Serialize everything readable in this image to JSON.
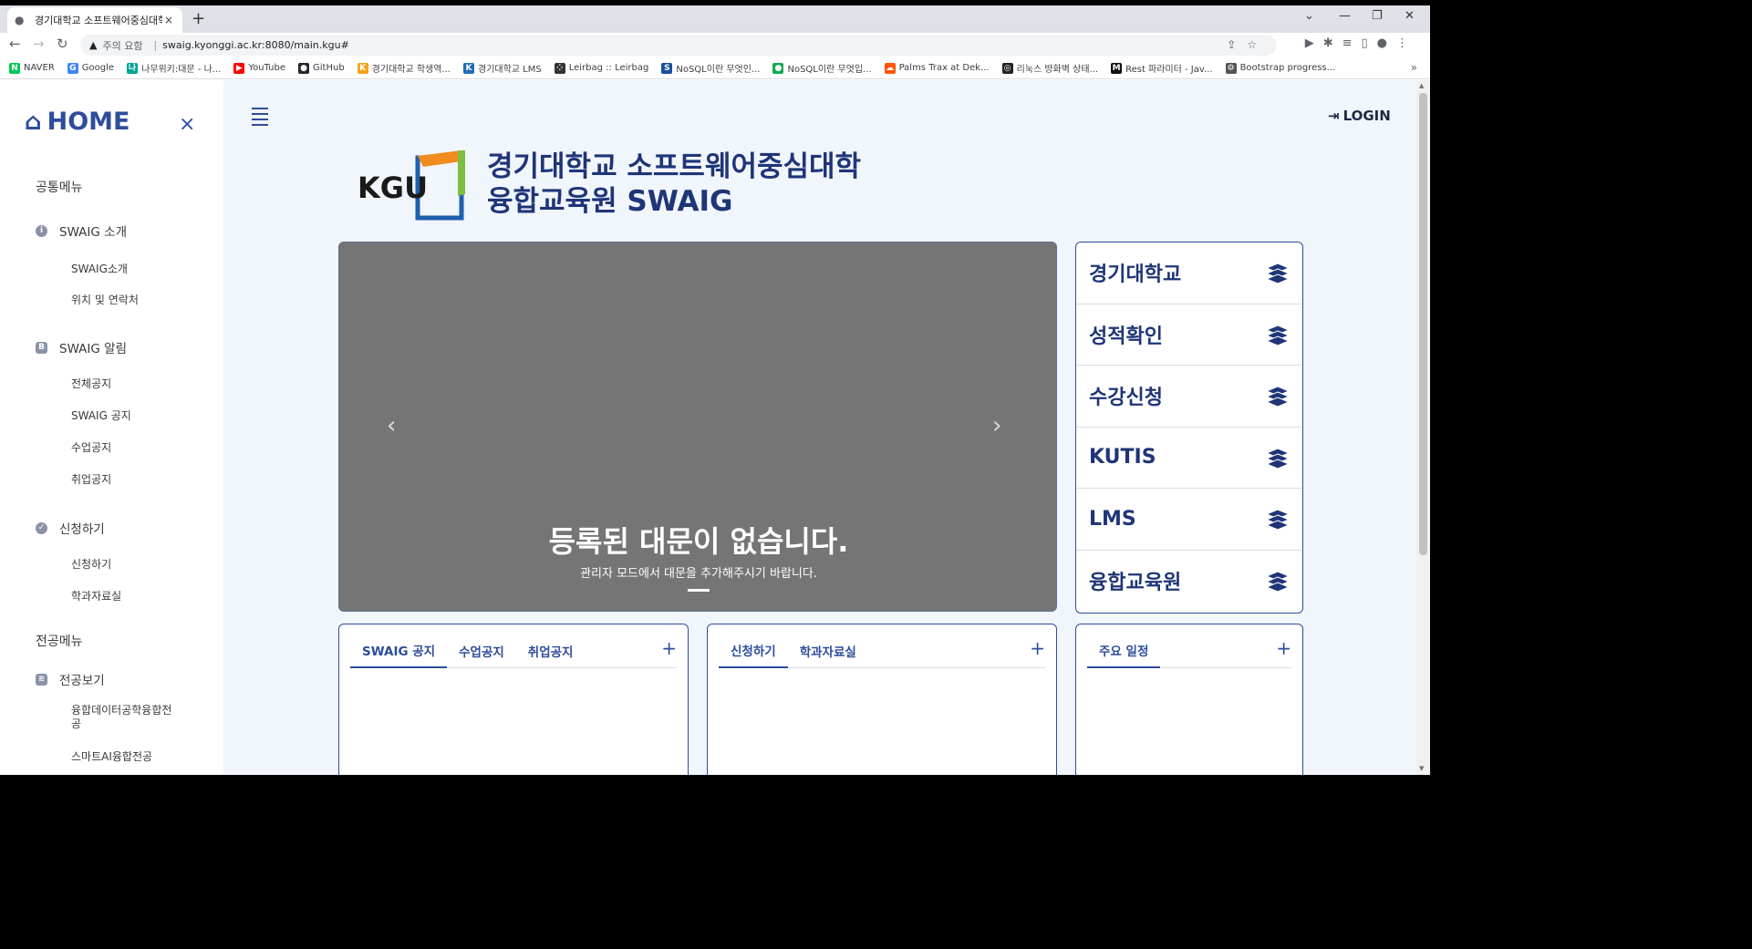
{
  "browser": {
    "tab_title": "경기대학교 소프트웨어중심대학",
    "tab_close": "×",
    "new_tab": "+",
    "security_label": "주의 요함",
    "url": "swaig.kyonggi.ac.kr:8080/main.kgu#",
    "bookmarks": [
      {
        "label": "NAVER",
        "icon": "N",
        "color": "#03c75a"
      },
      {
        "label": "Google",
        "icon": "G",
        "color": "#4285f4"
      },
      {
        "label": "나무위키:대문 - 나...",
        "icon": "나",
        "color": "#00a495"
      },
      {
        "label": "YouTube",
        "icon": "▶",
        "color": "#ff0000"
      },
      {
        "label": "GitHub",
        "icon": "●",
        "color": "#24292f"
      },
      {
        "label": "경기대학교 학생역...",
        "icon": "K",
        "color": "#f7a21b"
      },
      {
        "label": "경기대학교 LMS",
        "icon": "K",
        "color": "#1f6fb5"
      },
      {
        "label": "Leirbag :: Leirbag",
        "icon": "⁘",
        "color": "#333333"
      },
      {
        "label": "NoSQL이란 무엇인...",
        "icon": "S",
        "color": "#1a4fa0"
      },
      {
        "label": "NoSQL이란 무엇입...",
        "icon": "●",
        "color": "#13aa52"
      },
      {
        "label": "Palms Trax at Dek...",
        "icon": "☁",
        "color": "#ff5500"
      },
      {
        "label": "리눅스 방화벽 상태...",
        "icon": "◎",
        "color": "#222222"
      },
      {
        "label": "Rest 파라미터 - Jav...",
        "icon": "M",
        "color": "#111111"
      },
      {
        "label": "Bootstrap progress...",
        "icon": "⚙",
        "color": "#555555"
      }
    ],
    "more": "»"
  },
  "sidebar": {
    "home_label": "HOME",
    "close": "×",
    "common_header": "공통메뉴",
    "group1": {
      "label": "SWAIG 소개",
      "icon": "i",
      "items": [
        "SWAIG소개",
        "위치 및 연락처"
      ]
    },
    "group2": {
      "label": "SWAIG 알림",
      "icon": "B",
      "items": [
        "전체공지",
        "SWAIG 공지",
        "수업공지",
        "취업공지"
      ]
    },
    "group3": {
      "label": "신청하기",
      "icon": "✓",
      "items": [
        "신청하기",
        "학과자료실"
      ]
    },
    "major_header": "전공메뉴",
    "group4": {
      "label": "전공보기",
      "icon": "≋",
      "items": [
        "융합데이터공학융합전공",
        "스마트AI융합전공"
      ]
    }
  },
  "header": {
    "login_label": "LOGIN",
    "logo_text": "KGU",
    "title_line1": "경기대학교 소프트웨어중심대학",
    "title_line2": "융합교육원 SWAIG"
  },
  "carousel": {
    "caption": "등록된 대문이 없습니다.",
    "subcaption": "관리자 모드에서 대문을 추가해주시기 바랍니다.",
    "prev": "‹",
    "next": "›"
  },
  "quick_links": [
    "경기대학교",
    "성적확인",
    "수강신청",
    "KUTIS",
    "LMS",
    "융합교육원"
  ],
  "boards": {
    "board1": {
      "tabs": [
        "SWAIG 공지",
        "수업공지",
        "취업공지"
      ],
      "plus": "+"
    },
    "board2": {
      "tabs": [
        "신청하기",
        "학과자료실"
      ],
      "plus": "+"
    },
    "board3": {
      "tabs": [
        "주요 일정"
      ],
      "plus": "+"
    }
  },
  "colors": {
    "accent": "#2e4d9b",
    "title": "#1f3577",
    "page_bg": "#f1f5fc",
    "carousel_bg": "#757575"
  }
}
